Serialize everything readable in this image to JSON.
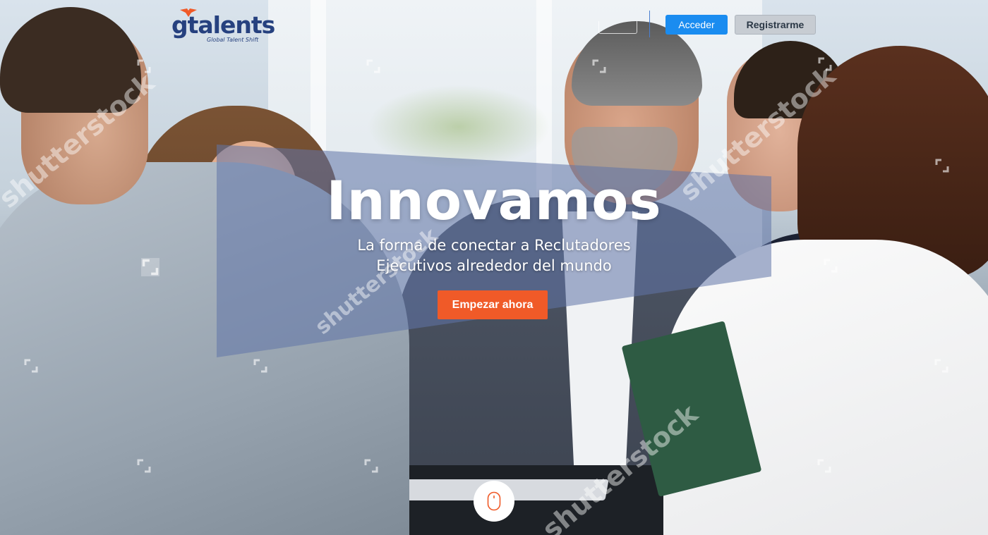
{
  "brand": {
    "name": "gtalents",
    "tagline": "Global Talent Shift",
    "primary_color": "#26417f",
    "accent_color": "#f05a28"
  },
  "header": {
    "language_label": "",
    "login_label": "Acceder",
    "register_label": "Registrarme"
  },
  "hero": {
    "title": "Innovamos",
    "subtitle_line1": "La forma de conectar a Reclutadores",
    "subtitle_line2": "Ejecutivos alrededor del mundo",
    "cta_label": "Empezar ahora"
  },
  "watermark": {
    "text": "shutterstock"
  },
  "icons": {
    "scroll": "mouse-icon",
    "watermark": "shutterstock-icon"
  }
}
